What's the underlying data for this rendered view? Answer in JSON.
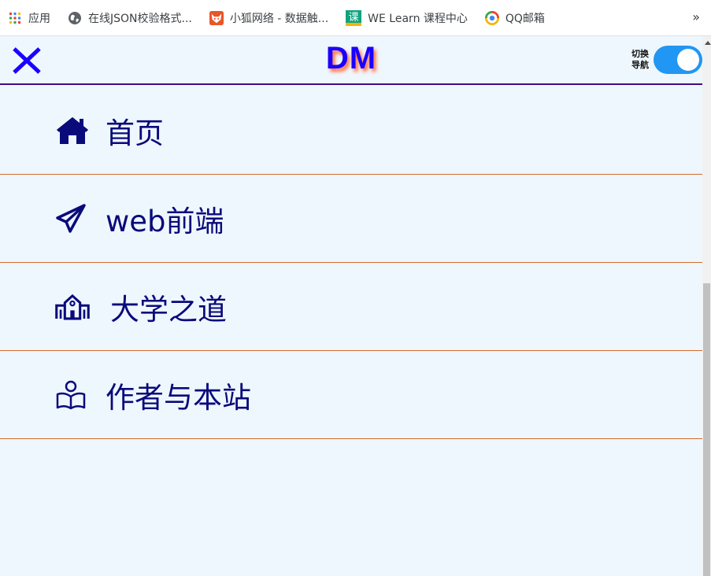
{
  "bookmarks": {
    "items": [
      {
        "label": "应用",
        "icon": "apps-grid-icon"
      },
      {
        "label": "在线JSON校验格式...",
        "icon": "globe-icon"
      },
      {
        "label": "小狐网络 - 数据触...",
        "icon": "fox-icon"
      },
      {
        "label": "WE Learn 课程中心",
        "icon": "course-icon"
      },
      {
        "label": "QQ邮箱",
        "icon": "qq-mail-icon"
      }
    ],
    "more": "»",
    "course_icon_glyph": "课"
  },
  "header": {
    "logo": "DM",
    "toggle_label_line1": "切换",
    "toggle_label_line2": "导航",
    "toggle_on": true
  },
  "nav": {
    "items": [
      {
        "label": "首页",
        "icon": "home-icon"
      },
      {
        "label": "web前端",
        "icon": "paper-plane-icon"
      },
      {
        "label": "大学之道",
        "icon": "school-icon"
      },
      {
        "label": "作者与本站",
        "icon": "reading-person-icon"
      }
    ]
  },
  "colors": {
    "page_bg": "#eef7fe",
    "nav_text": "#0a0a7a",
    "logo": "#1a00ff",
    "logo_shadow": "#ff6a3c",
    "header_border": "#3c0a8a",
    "item_border": "#d46a28",
    "toggle": "#2196f3",
    "close_icon": "#1a00ff"
  }
}
